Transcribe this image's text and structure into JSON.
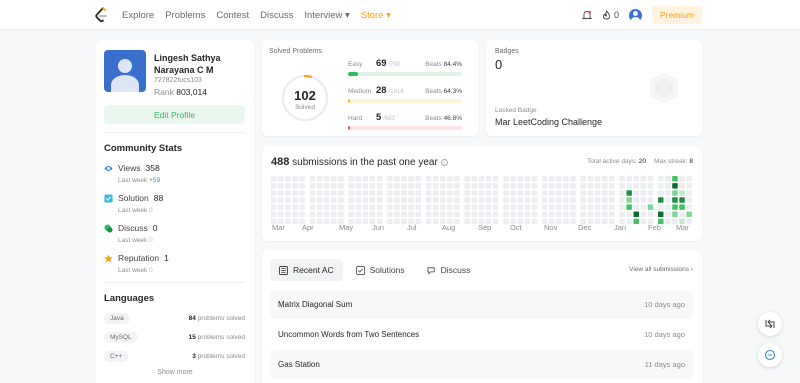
{
  "nav": {
    "links": [
      "Explore",
      "Problems",
      "Contest",
      "Discuss",
      "Interview ▾",
      "Store ▾"
    ],
    "notification_count": "0",
    "premium_label": "Premium"
  },
  "profile": {
    "name": "Lingesh Sathya Narayana C M",
    "username": "727822tucs103",
    "rank_label": "Rank",
    "rank_value": "803,014",
    "edit_label": "Edit Profile"
  },
  "community": {
    "title": "Community Stats",
    "items": [
      {
        "label": "Views",
        "value": "358",
        "lastweek": "Last week",
        "delta": "+59",
        "icon": "eye-icon",
        "color": "#3a87d9"
      },
      {
        "label": "Solution",
        "value": "88",
        "lastweek": "Last week",
        "delta": "0",
        "icon": "checkbox-icon",
        "color": "#35b8e0"
      },
      {
        "label": "Discuss",
        "value": "0",
        "lastweek": "Last week",
        "delta": "0",
        "icon": "discuss-icon",
        "color": "#2cbb5d"
      },
      {
        "label": "Reputation",
        "value": "1",
        "lastweek": "Last week",
        "delta": "0",
        "icon": "star-icon",
        "color": "#ffa116"
      }
    ]
  },
  "languages": {
    "title": "Languages",
    "items": [
      {
        "name": "Java",
        "count": "84",
        "suffix": "problems solved"
      },
      {
        "name": "MySQL",
        "count": "15",
        "suffix": "problems solved"
      },
      {
        "name": "C++",
        "count": "3",
        "suffix": "problems solved"
      }
    ],
    "show_more": "Show more"
  },
  "solved": {
    "label": "Solved Problems",
    "total": "102",
    "total_label": "Solved",
    "difficulties": [
      {
        "name": "Easy",
        "solved": "69",
        "total": "/790",
        "beats_label": "Beats",
        "beats": "84.4%",
        "fraction": 0.087,
        "color": "#2cbb5d",
        "track": "#dff3e6"
      },
      {
        "name": "Medium",
        "solved": "28",
        "total": "/1614",
        "beats_label": "Beats",
        "beats": "64.3%",
        "fraction": 0.017,
        "color": "#ffb800",
        "track": "#fff4d6"
      },
      {
        "name": "Hard",
        "solved": "5",
        "total": "/683",
        "beats_label": "Beats",
        "beats": "46.8%",
        "fraction": 0.007,
        "color": "#ef4743",
        "track": "#fde3e3"
      }
    ]
  },
  "badges": {
    "label": "Badges",
    "count": "0",
    "locked_label": "Locked Badge",
    "locked_name": "Mar LeetCoding Challenge"
  },
  "submissions": {
    "count": "488",
    "text": "submissions in the past one year",
    "active_days_label": "Total active days:",
    "active_days": "20",
    "max_streak_label": "Max streak:",
    "max_streak": "8",
    "months": [
      "Mar",
      "Apr",
      "May",
      "Jun",
      "Jul",
      "Aug",
      "Sep",
      "Oct",
      "Nov",
      "Dec",
      "Jan",
      "Feb",
      "Mar"
    ]
  },
  "recent": {
    "tabs": [
      {
        "label": "Recent AC",
        "icon": "list-icon"
      },
      {
        "label": "Solutions",
        "icon": "solution-icon"
      },
      {
        "label": "Discuss",
        "icon": "discuss-icon"
      }
    ],
    "view_all": "View all submissions",
    "rows": [
      {
        "title": "Matrix Diagonal Sum",
        "time": "10 days ago"
      },
      {
        "title": "Uncommon Words from Two Sentences",
        "time": "10 days ago"
      },
      {
        "title": "Gas Station",
        "time": "11 days ago"
      }
    ]
  }
}
